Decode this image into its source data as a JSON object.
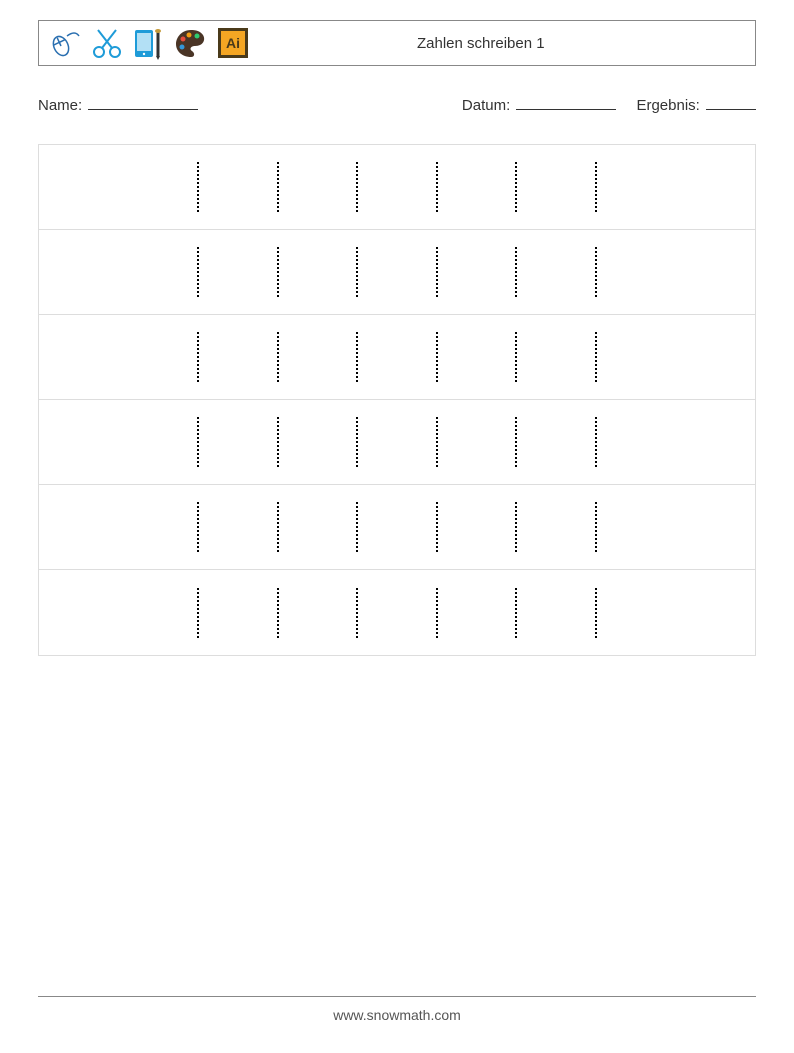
{
  "header": {
    "title": "Zahlen schreiben 1"
  },
  "fields": {
    "name_label": "Name:",
    "date_label": "Datum:",
    "result_label": "Ergebnis:"
  },
  "worksheet": {
    "rows": 6,
    "traces_per_row": 6
  },
  "footer": {
    "url": "www.snowmath.com"
  }
}
